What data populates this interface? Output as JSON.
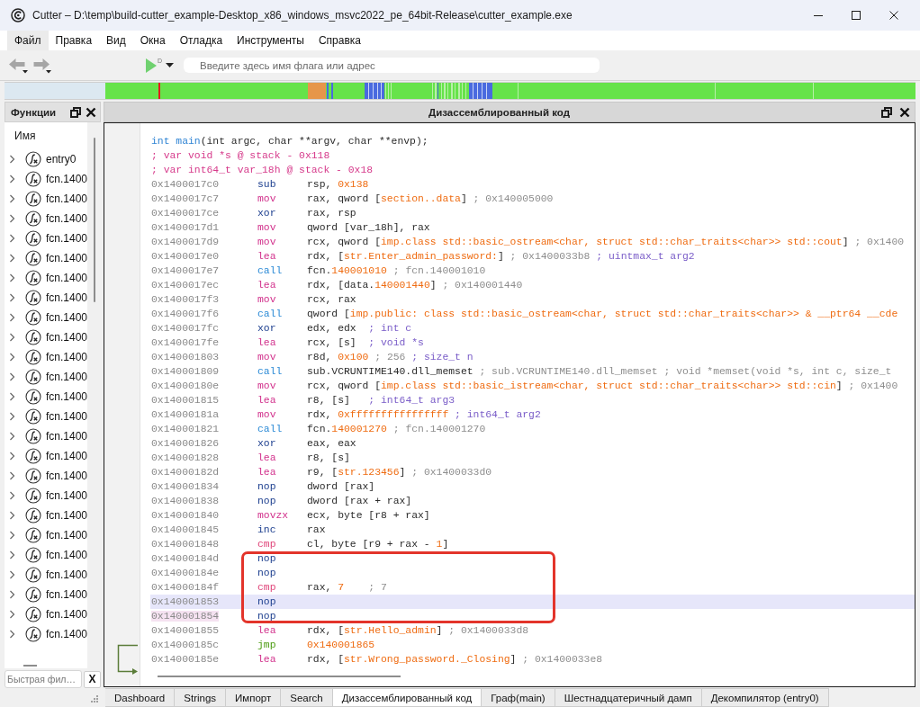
{
  "window": {
    "title": "Cutter – D:\\temp\\build-cutter_example-Desktop_x86_windows_msvc2022_pe_64bit-Release\\cutter_example.exe"
  },
  "menu": [
    {
      "label": "Файл",
      "selected": true
    },
    {
      "label": "Правка",
      "selected": false
    },
    {
      "label": "Вид",
      "selected": false
    },
    {
      "label": "Окна",
      "selected": false
    },
    {
      "label": "Отладка",
      "selected": false
    },
    {
      "label": "Инструменты",
      "selected": false
    },
    {
      "label": "Справка",
      "selected": false
    }
  ],
  "toolbar": {
    "back": {
      "disabled": true
    },
    "forward": {
      "disabled": true
    },
    "run_badge": "D",
    "search": {
      "placeholder": "Введите здесь имя флага или адрес"
    }
  },
  "functions_panel": {
    "title": "Функции",
    "column": "Имя",
    "items": [
      {
        "name": "entry0",
        "expanded": false
      },
      {
        "name": "fcn.1400",
        "expanded": false
      },
      {
        "name": "fcn.1400",
        "expanded": false
      },
      {
        "name": "fcn.1400",
        "expanded": false
      },
      {
        "name": "fcn.1400",
        "expanded": false
      },
      {
        "name": "fcn.1400",
        "expanded": false
      },
      {
        "name": "fcn.1400",
        "expanded": false
      },
      {
        "name": "fcn.1400",
        "expanded": false
      },
      {
        "name": "fcn.1400",
        "expanded": false
      },
      {
        "name": "fcn.1400",
        "expanded": false
      },
      {
        "name": "fcn.1400",
        "expanded": false
      },
      {
        "name": "fcn.1400",
        "expanded": false
      },
      {
        "name": "fcn.1400",
        "expanded": false
      },
      {
        "name": "fcn.1400",
        "expanded": false
      },
      {
        "name": "fcn.1400",
        "expanded": false
      },
      {
        "name": "fcn.1400",
        "expanded": false
      },
      {
        "name": "fcn.1400",
        "expanded": false
      },
      {
        "name": "fcn.1400",
        "expanded": false
      },
      {
        "name": "fcn.1400",
        "expanded": false
      },
      {
        "name": "fcn.1400",
        "expanded": false
      },
      {
        "name": "fcn.1400",
        "expanded": false
      },
      {
        "name": "fcn.1400",
        "expanded": false
      },
      {
        "name": "fcn.1400",
        "expanded": false
      },
      {
        "name": "fcn.1400",
        "expanded": false
      },
      {
        "name": "fcn.1400",
        "expanded": false
      }
    ],
    "filter": {
      "placeholder": "Быстрая фил…"
    },
    "clear_button": "X"
  },
  "disassembly_panel": {
    "title": "Дизассемблированный код",
    "signature": [
      {
        "text": "int main",
        "kind": "type"
      },
      {
        "text": "(int argc, char **argv, char **envp);",
        "kind": "plain"
      }
    ],
    "vars": [
      "; var void *s @ stack - 0x118",
      "; var int64_t var_18h @ stack - 0x18"
    ],
    "lines": [
      {
        "address": "0x1400017c0",
        "mnemonic": "sub",
        "kind": "arith",
        "operands": [
          {
            "text": "rsp, ",
            "kind": "plain"
          },
          {
            "text": "0x138",
            "kind": "number"
          }
        ],
        "selected": false,
        "marked": false,
        "boxed": false
      },
      {
        "address": "0x1400017c7",
        "mnemonic": "mov",
        "kind": "move",
        "operands": [
          {
            "text": "rax, qword [",
            "kind": "plain"
          },
          {
            "text": "section..data",
            "kind": "number"
          },
          {
            "text": "]",
            "kind": "plain"
          },
          {
            "text": " ; 0x140005000",
            "kind": "comment"
          }
        ],
        "selected": false,
        "marked": false,
        "boxed": false
      },
      {
        "address": "0x1400017ce",
        "mnemonic": "xor",
        "kind": "arith",
        "operands": [
          {
            "text": "rax, rsp",
            "kind": "plain"
          }
        ],
        "selected": false,
        "marked": false,
        "boxed": false
      },
      {
        "address": "0x1400017d1",
        "mnemonic": "mov",
        "kind": "move",
        "operands": [
          {
            "text": "qword [var_18h], rax",
            "kind": "plain"
          }
        ],
        "selected": false,
        "marked": false,
        "boxed": false
      },
      {
        "address": "0x1400017d9",
        "mnemonic": "mov",
        "kind": "move",
        "operands": [
          {
            "text": "rcx, qword [",
            "kind": "plain"
          },
          {
            "text": "imp.class std::basic_ostream<char, struct std::char_traits<char>> std::cout",
            "kind": "number"
          },
          {
            "text": "]",
            "kind": "plain"
          },
          {
            "text": " ; 0x1400",
            "kind": "comment"
          }
        ],
        "selected": false,
        "marked": false,
        "boxed": false
      },
      {
        "address": "0x1400017e0",
        "mnemonic": "lea",
        "kind": "move",
        "operands": [
          {
            "text": "rdx, [",
            "kind": "plain"
          },
          {
            "text": "str.Enter_admin_password:",
            "kind": "number"
          },
          {
            "text": "]",
            "kind": "plain"
          },
          {
            "text": " ; 0x1400033b8",
            "kind": "comment"
          },
          {
            "text": " ; uintmax_t arg2",
            "kind": "hint"
          }
        ],
        "selected": false,
        "marked": false,
        "boxed": false
      },
      {
        "address": "0x1400017e7",
        "mnemonic": "call",
        "kind": "call",
        "operands": [
          {
            "text": "fcn.",
            "kind": "plain"
          },
          {
            "text": "140001010",
            "kind": "number"
          },
          {
            "text": " ; fcn.140001010",
            "kind": "comment"
          }
        ],
        "selected": false,
        "marked": false,
        "boxed": false
      },
      {
        "address": "0x1400017ec",
        "mnemonic": "lea",
        "kind": "move",
        "operands": [
          {
            "text": "rdx, [data.",
            "kind": "plain"
          },
          {
            "text": "140001440",
            "kind": "number"
          },
          {
            "text": "]",
            "kind": "plain"
          },
          {
            "text": " ; 0x140001440",
            "kind": "comment"
          }
        ],
        "selected": false,
        "marked": false,
        "boxed": false
      },
      {
        "address": "0x1400017f3",
        "mnemonic": "mov",
        "kind": "move",
        "operands": [
          {
            "text": "rcx, rax",
            "kind": "plain"
          }
        ],
        "selected": false,
        "marked": false,
        "boxed": false
      },
      {
        "address": "0x1400017f6",
        "mnemonic": "call",
        "kind": "call",
        "operands": [
          {
            "text": "qword [",
            "kind": "plain"
          },
          {
            "text": "imp.public: class std::basic_ostream<char, struct std::char_traits<char>> & __ptr64 __cde",
            "kind": "number"
          }
        ],
        "selected": false,
        "marked": false,
        "boxed": false
      },
      {
        "address": "0x1400017fc",
        "mnemonic": "xor",
        "kind": "arith",
        "operands": [
          {
            "text": "edx, edx",
            "kind": "plain"
          },
          {
            "text": "  ; int c",
            "kind": "hint"
          }
        ],
        "selected": false,
        "marked": false,
        "boxed": false
      },
      {
        "address": "0x1400017fe",
        "mnemonic": "lea",
        "kind": "move",
        "operands": [
          {
            "text": "rcx, [s]",
            "kind": "plain"
          },
          {
            "text": "  ; void *s",
            "kind": "hint"
          }
        ],
        "selected": false,
        "marked": false,
        "boxed": false
      },
      {
        "address": "0x140001803",
        "mnemonic": "mov",
        "kind": "move",
        "operands": [
          {
            "text": "r8d, ",
            "kind": "plain"
          },
          {
            "text": "0x100",
            "kind": "number"
          },
          {
            "text": " ; 256",
            "kind": "comment"
          },
          {
            "text": " ; size_t n",
            "kind": "hint"
          }
        ],
        "selected": false,
        "marked": false,
        "boxed": false
      },
      {
        "address": "0x140001809",
        "mnemonic": "call",
        "kind": "call",
        "operands": [
          {
            "text": "sub.VCRUNTIME140.dll_memset",
            "kind": "plain"
          },
          {
            "text": " ; sub.VCRUNTIME140.dll_memset ; void *memset(void *s, int c, size_t",
            "kind": "comment"
          }
        ],
        "selected": false,
        "marked": false,
        "boxed": false
      },
      {
        "address": "0x14000180e",
        "mnemonic": "mov",
        "kind": "move",
        "operands": [
          {
            "text": "rcx, qword [",
            "kind": "plain"
          },
          {
            "text": "imp.class std::basic_istream<char, struct std::char_traits<char>> std::cin",
            "kind": "number"
          },
          {
            "text": "]",
            "kind": "plain"
          },
          {
            "text": " ; 0x1400",
            "kind": "comment"
          }
        ],
        "selected": false,
        "marked": false,
        "boxed": false
      },
      {
        "address": "0x140001815",
        "mnemonic": "lea",
        "kind": "move",
        "operands": [
          {
            "text": "r8, [s]",
            "kind": "plain"
          },
          {
            "text": "   ; int64_t arg3",
            "kind": "hint"
          }
        ],
        "selected": false,
        "marked": false,
        "boxed": false
      },
      {
        "address": "0x14000181a",
        "mnemonic": "mov",
        "kind": "move",
        "operands": [
          {
            "text": "rdx, ",
            "kind": "plain"
          },
          {
            "text": "0xffffffffffffffff",
            "kind": "number"
          },
          {
            "text": " ; int64_t arg2",
            "kind": "hint"
          }
        ],
        "selected": false,
        "marked": false,
        "boxed": false
      },
      {
        "address": "0x140001821",
        "mnemonic": "call",
        "kind": "call",
        "operands": [
          {
            "text": "fcn.",
            "kind": "plain"
          },
          {
            "text": "140001270",
            "kind": "number"
          },
          {
            "text": " ; fcn.140001270",
            "kind": "comment"
          }
        ],
        "selected": false,
        "marked": false,
        "boxed": false
      },
      {
        "address": "0x140001826",
        "mnemonic": "xor",
        "kind": "arith",
        "operands": [
          {
            "text": "eax, eax",
            "kind": "plain"
          }
        ],
        "selected": false,
        "marked": false,
        "boxed": false
      },
      {
        "address": "0x140001828",
        "mnemonic": "lea",
        "kind": "move",
        "operands": [
          {
            "text": "r8, [s]",
            "kind": "plain"
          }
        ],
        "selected": false,
        "marked": false,
        "boxed": false
      },
      {
        "address": "0x14000182d",
        "mnemonic": "lea",
        "kind": "move",
        "operands": [
          {
            "text": "r9, [",
            "kind": "plain"
          },
          {
            "text": "str.123456",
            "kind": "number"
          },
          {
            "text": "]",
            "kind": "plain"
          },
          {
            "text": " ; 0x1400033d0",
            "kind": "comment"
          }
        ],
        "selected": false,
        "marked": false,
        "boxed": false
      },
      {
        "address": "0x140001834",
        "mnemonic": "nop",
        "kind": "nop",
        "operands": [
          {
            "text": "dword [rax]",
            "kind": "plain"
          }
        ],
        "selected": false,
        "marked": false,
        "boxed": false
      },
      {
        "address": "0x140001838",
        "mnemonic": "nop",
        "kind": "nop",
        "operands": [
          {
            "text": "dword [rax + rax]",
            "kind": "plain"
          }
        ],
        "selected": false,
        "marked": false,
        "boxed": false
      },
      {
        "address": "0x140001840",
        "mnemonic": "movzx",
        "kind": "move",
        "operands": [
          {
            "text": "ecx, byte [r8 + rax]",
            "kind": "plain"
          }
        ],
        "selected": false,
        "marked": false,
        "boxed": false
      },
      {
        "address": "0x140001845",
        "mnemonic": "inc",
        "kind": "arith",
        "operands": [
          {
            "text": "rax",
            "kind": "plain"
          }
        ],
        "selected": false,
        "marked": false,
        "boxed": false
      },
      {
        "address": "0x140001848",
        "mnemonic": "cmp",
        "kind": "compare",
        "operands": [
          {
            "text": "cl, byte [r9 + rax - ",
            "kind": "plain"
          },
          {
            "text": "1",
            "kind": "number"
          },
          {
            "text": "]",
            "kind": "plain"
          }
        ],
        "selected": false,
        "marked": false,
        "boxed": false
      },
      {
        "address": "0x14000184d",
        "mnemonic": "nop",
        "kind": "nop",
        "selected": false,
        "marked": false,
        "boxed": true
      },
      {
        "address": "0x14000184e",
        "mnemonic": "nop",
        "kind": "nop",
        "selected": false,
        "marked": false,
        "boxed": true
      },
      {
        "address": "0x14000184f",
        "mnemonic": "cmp",
        "kind": "compare",
        "operands": [
          {
            "text": "rax, ",
            "kind": "plain"
          },
          {
            "text": "7",
            "kind": "number"
          },
          {
            "text": "    ; 7",
            "kind": "comment"
          }
        ],
        "selected": false,
        "marked": false,
        "boxed": true
      },
      {
        "address": "0x140001853",
        "mnemonic": "nop",
        "kind": "nop",
        "selected": true,
        "marked": false,
        "boxed": true
      },
      {
        "address": "0x140001854",
        "mnemonic": "nop",
        "kind": "nop",
        "selected": false,
        "marked": true,
        "boxed": true
      },
      {
        "address": "0x140001855",
        "mnemonic": "lea",
        "kind": "move",
        "operands": [
          {
            "text": "rdx, [",
            "kind": "plain"
          },
          {
            "text": "str.Hello_admin",
            "kind": "number"
          },
          {
            "text": "]",
            "kind": "plain"
          },
          {
            "text": " ; 0x1400033d8",
            "kind": "comment"
          }
        ],
        "selected": false,
        "marked": false,
        "boxed": false
      },
      {
        "address": "0x14000185c",
        "mnemonic": "jmp",
        "kind": "jump",
        "operands": [
          {
            "text": "0x140001865",
            "kind": "number"
          }
        ],
        "selected": false,
        "marked": false,
        "boxed": false
      },
      {
        "address": "0x14000185e",
        "mnemonic": "lea",
        "kind": "move",
        "operands": [
          {
            "text": "rdx, [",
            "kind": "plain"
          },
          {
            "text": "str.Wrong_password._Closing",
            "kind": "number"
          },
          {
            "text": "]",
            "kind": "plain"
          },
          {
            "text": " ; 0x1400033e8",
            "kind": "comment"
          }
        ],
        "selected": false,
        "marked": false,
        "boxed": false
      }
    ]
  },
  "bottom_tabs": [
    {
      "label": "Dashboard",
      "selected": false
    },
    {
      "label": "Strings",
      "selected": false
    },
    {
      "label": "Импорт",
      "selected": false
    },
    {
      "label": "Search",
      "selected": false
    },
    {
      "label": "Дизассемблированный код",
      "selected": true
    },
    {
      "label": "Граф(main)",
      "selected": false
    },
    {
      "label": "Шестнадцатеричный дамп",
      "selected": false
    },
    {
      "label": "Декомпилятор (entry0)",
      "selected": false
    }
  ]
}
